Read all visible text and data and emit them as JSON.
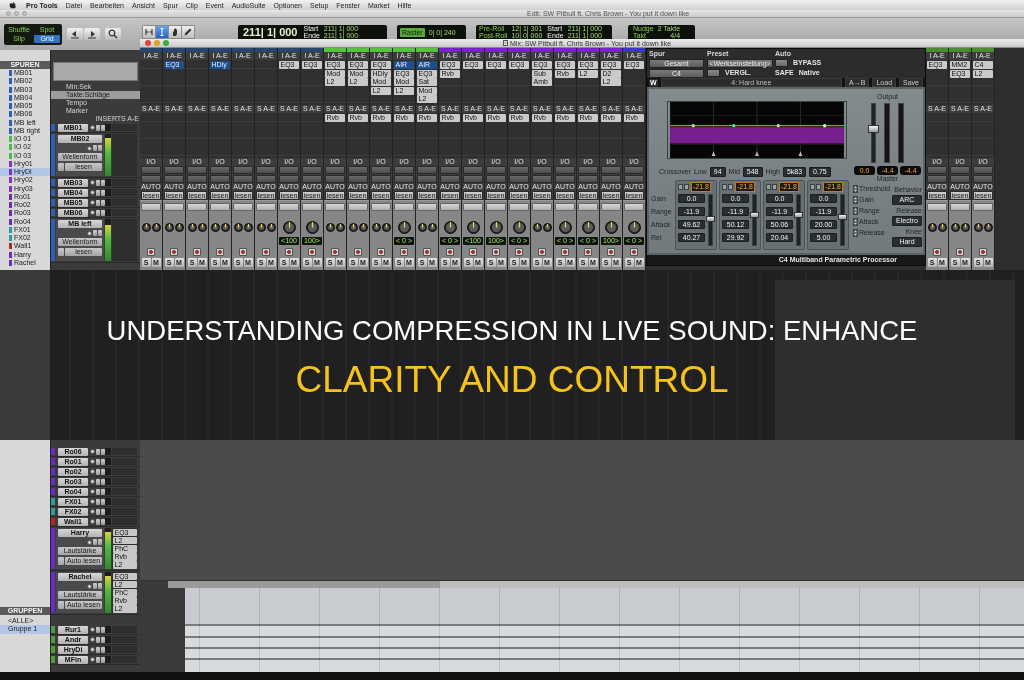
{
  "menu_bar": {
    "app": "Pro Tools",
    "items": [
      "Datei",
      "Bearbeiten",
      "Ansicht",
      "Spur",
      "Clip",
      "Event",
      "AudioSuite",
      "Optionen",
      "Setup",
      "Fenster",
      "Market",
      "Hilfe"
    ]
  },
  "edit_window": {
    "title": "Edit: SW Pitbull ft. Chris Brown - You put it down like",
    "edit_modes": [
      {
        "label": "Shuffle",
        "selected": false
      },
      {
        "label": "Spot",
        "selected": false
      },
      {
        "label": "Slip",
        "selected": false
      },
      {
        "label": "Grid",
        "selected": true
      }
    ],
    "tools": [
      {
        "kind": "trim",
        "selected": false
      },
      {
        "kind": "selector",
        "selected": true
      },
      {
        "kind": "grabber",
        "selected": false
      },
      {
        "kind": "pencil",
        "selected": false
      }
    ],
    "counter": {
      "main": "211| 1| 000",
      "rows": [
        {
          "label": "Start",
          "value": "211| 1| 000"
        },
        {
          "label": "Ende",
          "value": "211| 1| 000"
        }
      ]
    },
    "grid": {
      "label": "Raster",
      "value": "0| 0| 240"
    },
    "secondary_counter": {
      "rows": [
        {
          "label": "Pre-Roll",
          "value": "12| 1| 301"
        },
        {
          "label": "Post-Roll",
          "value": "10| 0| 000"
        }
      ],
      "range": [
        {
          "label": "Start",
          "value": "211| 1| 000"
        },
        {
          "label": "Ende",
          "value": "211| 1| 000"
        }
      ]
    },
    "nudge": {
      "label": "Nudge",
      "value": "2 Takte",
      "meter_label": "Takt",
      "meter": "4/4"
    },
    "track_list": {
      "title": "SPUREN",
      "items": [
        {
          "name": "MB01",
          "color": "#2f5fb5",
          "selected": false
        },
        {
          "name": "MB02",
          "color": "#2f5fb5",
          "selected": false
        },
        {
          "name": "MB03",
          "color": "#2f5fb5",
          "selected": false
        },
        {
          "name": "MB04",
          "color": "#2f5fb5",
          "selected": false
        },
        {
          "name": "MB05",
          "color": "#2f5fb5",
          "selected": false
        },
        {
          "name": "MB06",
          "color": "#2f5fb5",
          "selected": false
        },
        {
          "name": "MB left",
          "color": "#2f5fb5",
          "selected": false
        },
        {
          "name": "MB right",
          "color": "#2f5fb5",
          "selected": false
        },
        {
          "name": "IO 01",
          "color": "#4fb848",
          "selected": false
        },
        {
          "name": "IO 02",
          "color": "#4fb848",
          "selected": false
        },
        {
          "name": "IO 03",
          "color": "#4fb848",
          "selected": false
        },
        {
          "name": "Hry01",
          "color": "#7a35c8",
          "selected": false
        },
        {
          "name": "HryDi",
          "color": "#7a35c8",
          "selected": true
        },
        {
          "name": "Hry02",
          "color": "#7a35c8",
          "selected": false
        },
        {
          "name": "Hry03",
          "color": "#7a35c8",
          "selected": false
        },
        {
          "name": "Ro01",
          "color": "#6a2bc0",
          "selected": false
        },
        {
          "name": "Ro02",
          "color": "#6a2bc0",
          "selected": false
        },
        {
          "name": "Ro03",
          "color": "#6a2bc0",
          "selected": false
        },
        {
          "name": "Ro04",
          "color": "#6a2bc0",
          "selected": false
        },
        {
          "name": "FX01",
          "color": "#2e9a9a",
          "selected": false
        },
        {
          "name": "FX02",
          "color": "#2e9a9a",
          "selected": false
        },
        {
          "name": "Wall1",
          "color": "#b02a2a",
          "selected": false
        },
        {
          "name": "Harry",
          "color": "#6a2bc0",
          "selected": false
        },
        {
          "name": "Rachel",
          "color": "#6a2bc0",
          "selected": false
        }
      ]
    },
    "rulers": [
      {
        "label": "Min:Sek",
        "selected": false
      },
      {
        "label": "Takte:Schläge",
        "selected": true
      },
      {
        "label": "Tempo",
        "selected": false
      },
      {
        "label": "Marker",
        "selected": false
      }
    ],
    "inserts_header": "INSERTS A-E",
    "tracks_upper": [
      {
        "name": "MB01",
        "kind": "collapsed",
        "color": "#2f5fb5"
      },
      {
        "name": "MB02",
        "kind": "expanded",
        "color": "#2f5fb5",
        "level": 0.9,
        "view": "Wellenform",
        "automation": "lesen"
      },
      {
        "name": "MB03",
        "kind": "collapsed",
        "color": "#2f5fb5"
      },
      {
        "name": "MB04",
        "kind": "collapsed",
        "color": "#2f5fb5"
      },
      {
        "name": "MB05",
        "kind": "collapsed",
        "color": "#2f5fb5"
      },
      {
        "name": "MB06",
        "kind": "collapsed",
        "color": "#2f5fb5"
      },
      {
        "name": "MB left",
        "kind": "expanded",
        "color": "#2f5fb5",
        "level": 0.85,
        "view": "Wellenform",
        "automation": "lesen"
      }
    ],
    "tracks_lower": [
      {
        "name": "Ro06",
        "kind": "collapsed",
        "color": "#6a2bc0"
      },
      {
        "name": "Ro01",
        "kind": "collapsed",
        "color": "#6a2bc0"
      },
      {
        "name": "Ro02",
        "kind": "collapsed",
        "color": "#6a2bc0"
      },
      {
        "name": "Ro03",
        "kind": "collapsed",
        "color": "#6a2bc0"
      },
      {
        "name": "Ro04",
        "kind": "collapsed",
        "color": "#6a2bc0"
      },
      {
        "name": "FX01",
        "kind": "collapsed",
        "color": "#2e9a9a"
      },
      {
        "name": "FX02",
        "kind": "collapsed",
        "color": "#2e9a9a"
      },
      {
        "name": "Wall1",
        "kind": "collapsed",
        "color": "#b02a2a"
      },
      {
        "name": "Harry",
        "kind": "expanded",
        "color": "#6a2bc0",
        "level": 0.9,
        "view": "Lautstärke",
        "automation": "Auto lesen",
        "inserts": [
          "EQ3",
          "L2",
          "PhC",
          "Rvb",
          "L2"
        ]
      },
      {
        "name": "Rachel",
        "kind": "expanded",
        "color": "#6a2bc0",
        "level": 0.9,
        "view": "Lautstärke",
        "automation": "Auto lesen",
        "inserts": [
          "EQ3",
          "L2",
          "PhC",
          "Rvb",
          "L2"
        ]
      },
      {
        "name": "Rur1",
        "kind": "collapsed",
        "color": "#4e9a3c"
      },
      {
        "name": "Andr",
        "kind": "collapsed",
        "color": "#4e9a3c"
      },
      {
        "name": "HryDi",
        "kind": "collapsed",
        "color": "#4e9a3c"
      },
      {
        "name": "MFin",
        "kind": "collapsed",
        "color": "#4e9a3c"
      }
    ],
    "groups": {
      "title": "GRUPPEN",
      "items": [
        {
          "label": "<ALLE>",
          "selected": false
        },
        {
          "label": "Gruppe 1",
          "selected": true
        }
      ]
    }
  },
  "mix_window": {
    "title": "Mix: SW Pitbull ft. Chris Brown - You put it down like",
    "strips_left": [
      {
        "color": "#28466f",
        "kind": "stereo",
        "insert_header": "I A-E",
        "send_header": "S A-E",
        "io_header": "I/O",
        "auto_header": "AUTO",
        "auto": "lesen",
        "solo": "S",
        "mute": "M"
      },
      {
        "color": "#28466f",
        "kind": "stereo",
        "insert_header": "I A-E",
        "inserts": [
          {
            "label": "EQ3",
            "highlighted": true
          }
        ],
        "send_header": "S A-E",
        "io_header": "I/O",
        "auto_header": "AUTO",
        "auto": "lesen",
        "solo": "S",
        "mute": "M"
      },
      {
        "color": "#28466f",
        "kind": "stereo",
        "insert_header": "I A-E",
        "send_header": "S A-E",
        "io_header": "I/O",
        "auto_header": "AUTO",
        "auto": "lesen",
        "solo": "S",
        "mute": "M"
      },
      {
        "color": "#28466f",
        "kind": "stereo",
        "insert_header": "I A-E",
        "inserts": [
          {
            "label": "HDly",
            "highlighted": true
          }
        ],
        "send_header": "S A-E",
        "io_header": "I/O",
        "auto_header": "AUTO",
        "auto": "lesen",
        "solo": "S",
        "mute": "M"
      },
      {
        "color": "#28466f",
        "kind": "stereo",
        "insert_header": "I A-E",
        "send_header": "S A-E",
        "io_header": "I/O",
        "auto_header": "AUTO",
        "auto": "lesen",
        "solo": "S",
        "mute": "M"
      },
      {
        "color": "#28466f",
        "kind": "stereo",
        "insert_header": "I A-E",
        "send_header": "S A-E",
        "io_header": "I/O",
        "auto_header": "AUTO",
        "auto": "lesen",
        "solo": "S",
        "mute": "M"
      },
      {
        "color": "#28466f",
        "kind": "mono",
        "insert_header": "I A-E",
        "inserts": [
          {
            "label": "EQ3",
            "highlighted": false
          }
        ],
        "send_header": "S A-E",
        "io_header": "I/O",
        "auto_header": "AUTO",
        "auto": "lesen",
        "pan_reading": "<100",
        "solo": "S",
        "mute": "M"
      },
      {
        "color": "#28466f",
        "kind": "mono",
        "insert_header": "I A-E",
        "inserts": [
          {
            "label": "EQ3",
            "highlighted": false
          }
        ],
        "send_header": "S A-E",
        "io_header": "I/O",
        "auto_header": "AUTO",
        "auto": "lesen",
        "pan_reading": "100>",
        "solo": "S",
        "mute": "M"
      },
      {
        "color": "#55c43a",
        "kind": "stereo",
        "insert_header": "I A-E",
        "inserts": [
          {
            "label": "EQ3",
            "highlighted": false
          },
          {
            "label": "Mod",
            "highlighted": false
          },
          {
            "label": "L2",
            "highlighted": false
          }
        ],
        "send_header": "S A-E",
        "sends": [
          "Rvb"
        ],
        "io_header": "I/O",
        "auto_header": "AUTO",
        "auto": "lesen",
        "solo": "S",
        "mute": "M"
      },
      {
        "color": "#55c43a",
        "kind": "stereo",
        "insert_header": "I A-E",
        "inserts": [
          {
            "label": "EQ3",
            "highlighted": false
          },
          {
            "label": "Mod",
            "highlighted": false
          },
          {
            "label": "L2",
            "highlighted": false
          }
        ],
        "send_header": "S A-E",
        "sends": [
          "Rvb"
        ],
        "io_header": "I/O",
        "auto_header": "AUTO",
        "auto": "lesen",
        "solo": "S",
        "mute": "M"
      },
      {
        "color": "#55c43a",
        "kind": "stereo",
        "insert_header": "I A-E",
        "inserts": [
          {
            "label": "EQ3",
            "highlighted": false
          },
          {
            "label": "HDly",
            "highlighted": false
          },
          {
            "label": "Mod",
            "highlighted": false
          },
          {
            "label": "L2",
            "highlighted": false
          }
        ],
        "send_header": "S A-E",
        "sends": [
          "Rvb"
        ],
        "io_header": "I/O",
        "auto_header": "AUTO",
        "auto": "lesen",
        "solo": "S",
        "mute": "M"
      },
      {
        "color": "#55c43a",
        "kind": "mono",
        "insert_header": "I A-E",
        "inserts": [
          {
            "label": "AIR",
            "highlighted": true
          },
          {
            "label": "EQ3",
            "highlighted": false
          },
          {
            "label": "Mod",
            "highlighted": false
          },
          {
            "label": "L2",
            "highlighted": false
          }
        ],
        "send_header": "S A-E",
        "sends": [
          "Rvb"
        ],
        "io_header": "I/O",
        "auto_header": "AUTO",
        "auto": "lesen",
        "pan_reading": "< 0 >",
        "solo": "S",
        "mute": "M"
      },
      {
        "color": "#55c43a",
        "kind": "stereo",
        "insert_header": "I A-E",
        "inserts": [
          {
            "label": "AIR",
            "highlighted": true
          },
          {
            "label": "EQ3",
            "highlighted": false
          },
          {
            "label": "Sat",
            "highlighted": false
          },
          {
            "label": "Mod",
            "highlighted": false
          },
          {
            "label": "L2",
            "highlighted": false
          }
        ],
        "send_header": "S A-E",
        "sends": [
          "Rvb"
        ],
        "io_header": "I/O",
        "auto_header": "AUTO",
        "auto": "lesen",
        "solo": "S",
        "mute": "M"
      },
      {
        "color": "#7b23c8",
        "kind": "mono",
        "insert_header": "I A-E",
        "inserts": [
          {
            "label": "EQ3",
            "highlighted": false
          },
          {
            "label": "Rvb",
            "highlighted": false
          }
        ],
        "send_header": "S A-E",
        "sends": [
          "Rvb"
        ],
        "io_header": "I/O",
        "auto_header": "AUTO",
        "auto": "lesen",
        "pan_reading": "< 0 >",
        "solo": "S",
        "mute": "M"
      },
      {
        "color": "#7b23c8",
        "kind": "mono",
        "insert_header": "I A-E",
        "inserts": [
          {
            "label": "EQ3",
            "highlighted": false
          }
        ],
        "send_header": "S A-E",
        "sends": [
          "Rvb"
        ],
        "io_header": "I/O",
        "auto_header": "AUTO",
        "auto": "lesen",
        "pan_reading": "<100",
        "solo": "S",
        "mute": "M"
      },
      {
        "color": "#7b23c8",
        "kind": "mono",
        "insert_header": "I A-E",
        "inserts": [
          {
            "label": "EQ3",
            "highlighted": false
          }
        ],
        "send_header": "S A-E",
        "sends": [
          "Rvb"
        ],
        "io_header": "I/O",
        "auto_header": "AUTO",
        "auto": "lesen",
        "pan_reading": "100>",
        "solo": "S",
        "mute": "M"
      },
      {
        "color": "#7b23c8",
        "kind": "mono",
        "insert_header": "I A-E",
        "inserts": [
          {
            "label": "EQ3",
            "highlighted": false
          }
        ],
        "send_header": "S A-E",
        "sends": [
          "Rvb"
        ],
        "io_header": "I/O",
        "auto_header": "AUTO",
        "auto": "lesen",
        "pan_reading": "< 0 >",
        "solo": "S",
        "mute": "M"
      },
      {
        "color": "#7b23c8",
        "kind": "stereo",
        "insert_header": "I A-E",
        "inserts": [
          {
            "label": "EQ3",
            "highlighted": false
          },
          {
            "label": "Sub",
            "highlighted": false
          },
          {
            "label": "Amb",
            "highlighted": false
          }
        ],
        "send_header": "S A-E",
        "sends": [
          "Rvb"
        ],
        "io_header": "I/O",
        "auto_header": "AUTO",
        "auto": "lesen",
        "solo": "S",
        "mute": "M"
      },
      {
        "color": "#7b23c8",
        "kind": "mono",
        "insert_header": "I A-E",
        "inserts": [
          {
            "label": "EQ3",
            "highlighted": false
          },
          {
            "label": "Rvb",
            "highlighted": false
          }
        ],
        "send_header": "S A-E",
        "sends": [
          "Rvb"
        ],
        "io_header": "I/O",
        "auto_header": "AUTO",
        "auto": "lesen",
        "pan_reading": "< 0 >",
        "solo": "S",
        "mute": "M"
      },
      {
        "color": "#7b23c8",
        "kind": "mono",
        "insert_header": "I A-E",
        "inserts": [
          {
            "label": "EQ3",
            "highlighted": false
          },
          {
            "label": "L2",
            "highlighted": false
          }
        ],
        "send_header": "S A-E",
        "sends": [
          "Rvb"
        ],
        "io_header": "I/O",
        "auto_header": "AUTO",
        "auto": "lesen",
        "pan_reading": "< 0 >",
        "solo": "S",
        "mute": "M"
      },
      {
        "color": "#7b23c8",
        "kind": "mono",
        "insert_header": "I A-E",
        "inserts": [
          {
            "label": "EQ3",
            "highlighted": false
          },
          {
            "label": "D2",
            "highlighted": false
          },
          {
            "label": "L2",
            "highlighted": false
          }
        ],
        "send_header": "S A-E",
        "sends": [
          "Rvb"
        ],
        "io_header": "I/O",
        "auto_header": "AUTO",
        "auto": "lesen",
        "pan_reading": "100>",
        "solo": "S",
        "mute": "M"
      },
      {
        "color": "#3b35cf",
        "kind": "mono",
        "insert_header": "I A-E",
        "inserts": [
          {
            "label": "EQ3",
            "highlighted": false
          }
        ],
        "send_header": "S A-E",
        "sends": [
          "Rvb"
        ],
        "io_header": "I/O",
        "auto_header": "AUTO",
        "auto": "lesen",
        "pan_reading": "< 0 >",
        "solo": "S",
        "mute": "M"
      }
    ],
    "strips_right": [
      {
        "color": "#4a8c2e",
        "kind": "stereo",
        "insert_header": "I A-E",
        "inserts": [
          {
            "label": "EQ3",
            "highlighted": false
          }
        ],
        "send_header": "S A-E",
        "io_header": "I/O",
        "auto_header": "AUTO",
        "auto": "lesen",
        "solo": "S",
        "mute": "M"
      },
      {
        "color": "#4a8c2e",
        "kind": "stereo",
        "insert_header": "I A-E",
        "inserts": [
          {
            "label": "MM2",
            "highlighted": false
          },
          {
            "label": "EQ3",
            "highlighted": false
          }
        ],
        "send_header": "S A-E",
        "io_header": "I/O",
        "auto_header": "AUTO",
        "auto": "lesen",
        "solo": "S",
        "mute": "M"
      },
      {
        "color": "#4a8c2e",
        "kind": "stereo",
        "insert_header": "I A-E",
        "inserts": [
          {
            "label": "C4",
            "highlighted": false
          },
          {
            "label": "L2",
            "highlighted": false
          }
        ],
        "send_header": "S A-E",
        "io_header": "I/O",
        "auto_header": "AUTO",
        "auto": "lesen",
        "solo": "S",
        "mute": "M"
      }
    ]
  },
  "plugin_window": {
    "track_label": "Spur",
    "preset_label": "Preset",
    "auto_label": "Auto",
    "track": "Gesamt",
    "preset": "<Werkseinstellung>",
    "bypass": "BYPASS",
    "plugin": "C4",
    "compare": "VERGL.",
    "safe": "SAFE",
    "mode": "Native",
    "logo": "W",
    "preset_display": "4: Hard knee",
    "toolbar_buttons": [
      "A→B",
      "Load",
      "Save"
    ],
    "crossover_label": "Crossover",
    "crossovers": [
      {
        "label": "Low",
        "value": "94"
      },
      {
        "label": "Mid",
        "value": "548"
      },
      {
        "label": "High",
        "value": "5k83"
      }
    ],
    "q_value": "0.75",
    "row_labels": [
      "Gain",
      "Range",
      "Attack",
      "Rel"
    ],
    "bands": [
      {
        "readout": "-21.8",
        "values": [
          "0.0",
          "-11.9",
          "49.62",
          "40.27"
        ],
        "level": 0.55
      },
      {
        "readout": "-21.8",
        "values": [
          "0.0",
          "-11.9",
          "50.12",
          "29.92"
        ],
        "level": 0.62
      },
      {
        "readout": "-21.8",
        "values": [
          "0.0",
          "-11.9",
          "50.06",
          "20.04"
        ],
        "level": 0.62
      },
      {
        "readout": "-21.8",
        "values": [
          "0.0",
          "-11.9",
          "20.00",
          "5.00"
        ],
        "level": 0.58
      }
    ],
    "output": {
      "label": "Output",
      "level": 0.6,
      "readouts": [
        "0.0",
        "-4.4",
        "-4.4"
      ],
      "master_label": "Master"
    },
    "link_labels": [
      "Threshold",
      "Gain",
      "Range",
      "Attack",
      "Release"
    ],
    "options": [
      {
        "label": "Behavior",
        "value": "ARC"
      },
      {
        "label": "Release",
        "value": "Electro"
      },
      {
        "label": "Knee",
        "value": "Hard"
      }
    ],
    "footer": "C4 Multiband Parametric Processor"
  },
  "headline": [
    {
      "text": "UNDERSTANDING COMPRESSION IN LIVE SOUND: ENHANCE",
      "kind": "plain"
    },
    {
      "text": "CLARITY AND CONTROL",
      "kind": "highlight"
    }
  ]
}
